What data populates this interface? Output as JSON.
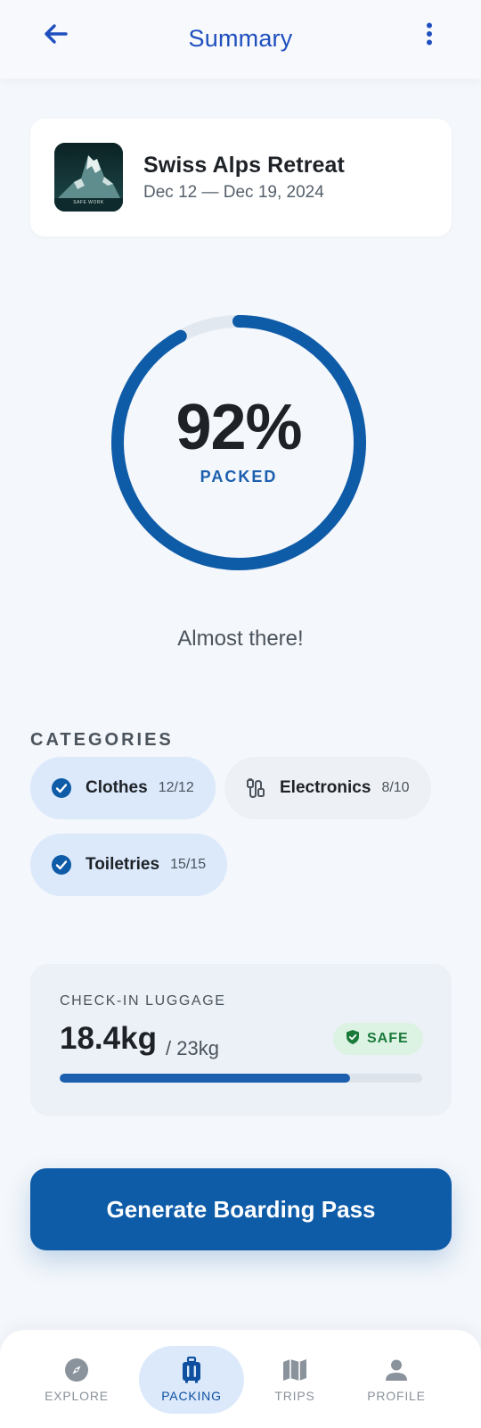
{
  "header": {
    "title": "Summary",
    "back_icon": "arrow-left-icon",
    "menu_icon": "more-vertical-icon"
  },
  "trip": {
    "name": "Swiss Alps Retreat",
    "dates": "Dec 12 — Dec 19, 2024",
    "thumbnail_caption": "SAFE WORK"
  },
  "progress": {
    "percent_value": 92,
    "percent_text": "92%",
    "label": "PACKED",
    "message": "Almost there!"
  },
  "categories": {
    "title": "CATEGORIES",
    "items": [
      {
        "label": "Clothes",
        "count": "12/12",
        "icon": "check-circle-icon",
        "status": "complete"
      },
      {
        "label": "Electronics",
        "count": "8/10",
        "icon": "cable-icon",
        "status": "partial"
      },
      {
        "label": "Toiletries",
        "count": "15/15",
        "icon": "check-circle-icon",
        "status": "complete"
      }
    ]
  },
  "luggage": {
    "title": "CHECK-IN LUGGAGE",
    "current": "18.4kg",
    "max": "/ 23kg",
    "badge": "SAFE",
    "badge_icon": "shield-check-icon",
    "fill_fraction": 0.8
  },
  "cta": {
    "label": "Generate Boarding Pass"
  },
  "nav": {
    "items": [
      {
        "label": "EXPLORE",
        "icon": "compass-icon",
        "active": false
      },
      {
        "label": "PACKING",
        "icon": "luggage-icon",
        "active": true
      },
      {
        "label": "TRIPS",
        "icon": "map-icon",
        "active": false
      },
      {
        "label": "PROFILE",
        "icon": "person-icon",
        "active": false
      }
    ]
  },
  "colors": {
    "primary": "#0e5ba8",
    "title_blue": "#1f4fbf",
    "ring_track": "#e2e8ef",
    "safe_green": "#1a7a3a"
  }
}
